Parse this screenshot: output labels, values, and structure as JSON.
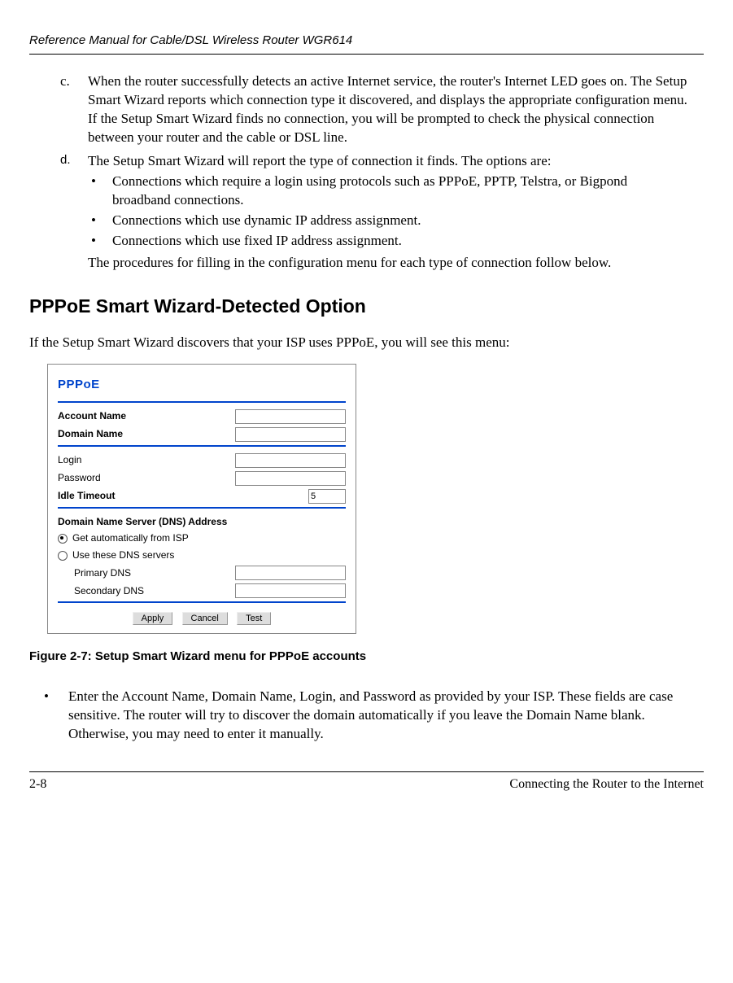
{
  "doc_title": "Reference Manual for Cable/DSL Wireless Router WGR614",
  "items": {
    "c": {
      "marker": "c.",
      "text": "When the router successfully detects an active Internet service, the router's Internet LED goes on. The Setup Smart Wizard reports which connection type it discovered, and displays the appropriate configuration menu. If the Setup Smart Wizard finds no connection, you will be prompted to check the physical connection between your router and the cable or DSL line."
    },
    "d": {
      "marker": "d.",
      "intro": "The Setup Smart Wizard will report the type of connection it finds. The options are:",
      "bullets": [
        "Connections which require a login using protocols such as PPPoE, PPTP, Telstra, or Bigpond broadband connections.",
        "Connections which use dynamic IP address assignment.",
        "Connections which use fixed IP address assignment."
      ],
      "outro": "The procedures for filling in the configuration menu for each type of connection follow below."
    }
  },
  "heading": "PPPoE Smart Wizard-Detected Option",
  "intro_para": "If the Setup Smart Wizard discovers that your ISP uses PPPoE, you will see this menu:",
  "figure": {
    "title": "PPPoE",
    "rows1": [
      {
        "label": "Account Name",
        "bold": true
      },
      {
        "label": "Domain Name",
        "bold": true
      }
    ],
    "rows2": [
      {
        "label": "Login",
        "bold": false
      },
      {
        "label": "Password",
        "bold": false
      }
    ],
    "idle": {
      "label": "Idle Timeout",
      "value": "5"
    },
    "dns_heading": "Domain Name Server (DNS) Address",
    "dns_opts": [
      {
        "label": "Get automatically from ISP",
        "checked": true
      },
      {
        "label": "Use these DNS servers",
        "checked": false
      }
    ],
    "dns_rows": [
      "Primary DNS",
      "Secondary DNS"
    ],
    "buttons": [
      "Apply",
      "Cancel",
      "Test"
    ]
  },
  "figure_caption": "Figure 2-7:  Setup Smart Wizard menu for PPPoE accounts",
  "final_bullet": "Enter the Account Name, Domain Name, Login, and Password as provided by your ISP. These fields are case sensitive. The router will try to discover the domain automatically if you leave the Domain Name blank. Otherwise, you may need to enter it manually.",
  "footer": {
    "page": "2-8",
    "title": "Connecting the Router to the Internet"
  }
}
